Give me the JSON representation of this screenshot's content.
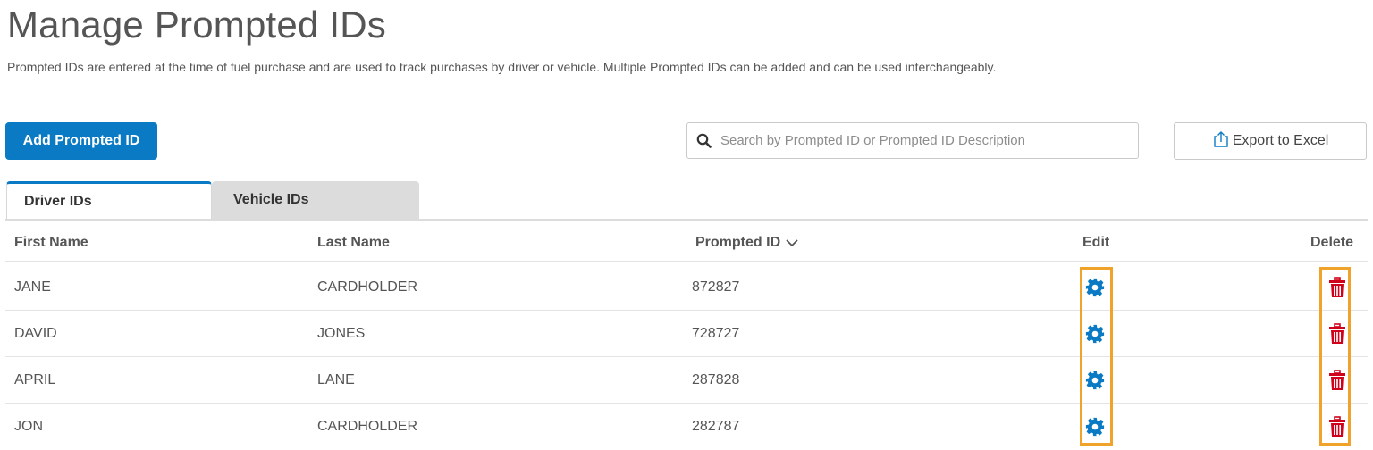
{
  "page": {
    "title": "Manage Prompted IDs",
    "subtitle": "Prompted IDs are entered at the time of fuel purchase and are used to track purchases by driver or vehicle.  Multiple Prompted IDs can be added and can be used interchangeably."
  },
  "toolbar": {
    "add_label": "Add Prompted ID",
    "search_placeholder": "Search by Prompted ID or Prompted ID Description",
    "search_value": "",
    "export_label": "Export to Excel"
  },
  "tabs": [
    {
      "label": "Driver IDs",
      "active": true
    },
    {
      "label": "Vehicle IDs",
      "active": false
    }
  ],
  "table": {
    "headers": {
      "first_name": "First Name",
      "last_name": "Last Name",
      "prompted_id": "Prompted ID",
      "edit": "Edit",
      "delete": "Delete"
    },
    "sort": {
      "column": "prompted_id",
      "direction": "descending"
    },
    "rows": [
      {
        "first_name": "JANE",
        "last_name": "CARDHOLDER",
        "prompted_id": "872827"
      },
      {
        "first_name": "DAVID",
        "last_name": "JONES",
        "prompted_id": "728727"
      },
      {
        "first_name": "APRIL",
        "last_name": "LANE",
        "prompted_id": "287828"
      },
      {
        "first_name": "JON",
        "last_name": "CARDHOLDER",
        "prompted_id": "282787"
      }
    ]
  },
  "icons": {
    "search": "search-icon",
    "export": "export-upload-icon",
    "sort": "chevron-down-icon",
    "edit": "gear-icon",
    "delete": "trash-icon"
  },
  "colors": {
    "primary": "#0a7ac4",
    "edit_icon": "#0a7ac4",
    "delete_icon": "#d0021b",
    "highlight": "#f0a32a",
    "inactive_tab": "#dcdcdc"
  }
}
